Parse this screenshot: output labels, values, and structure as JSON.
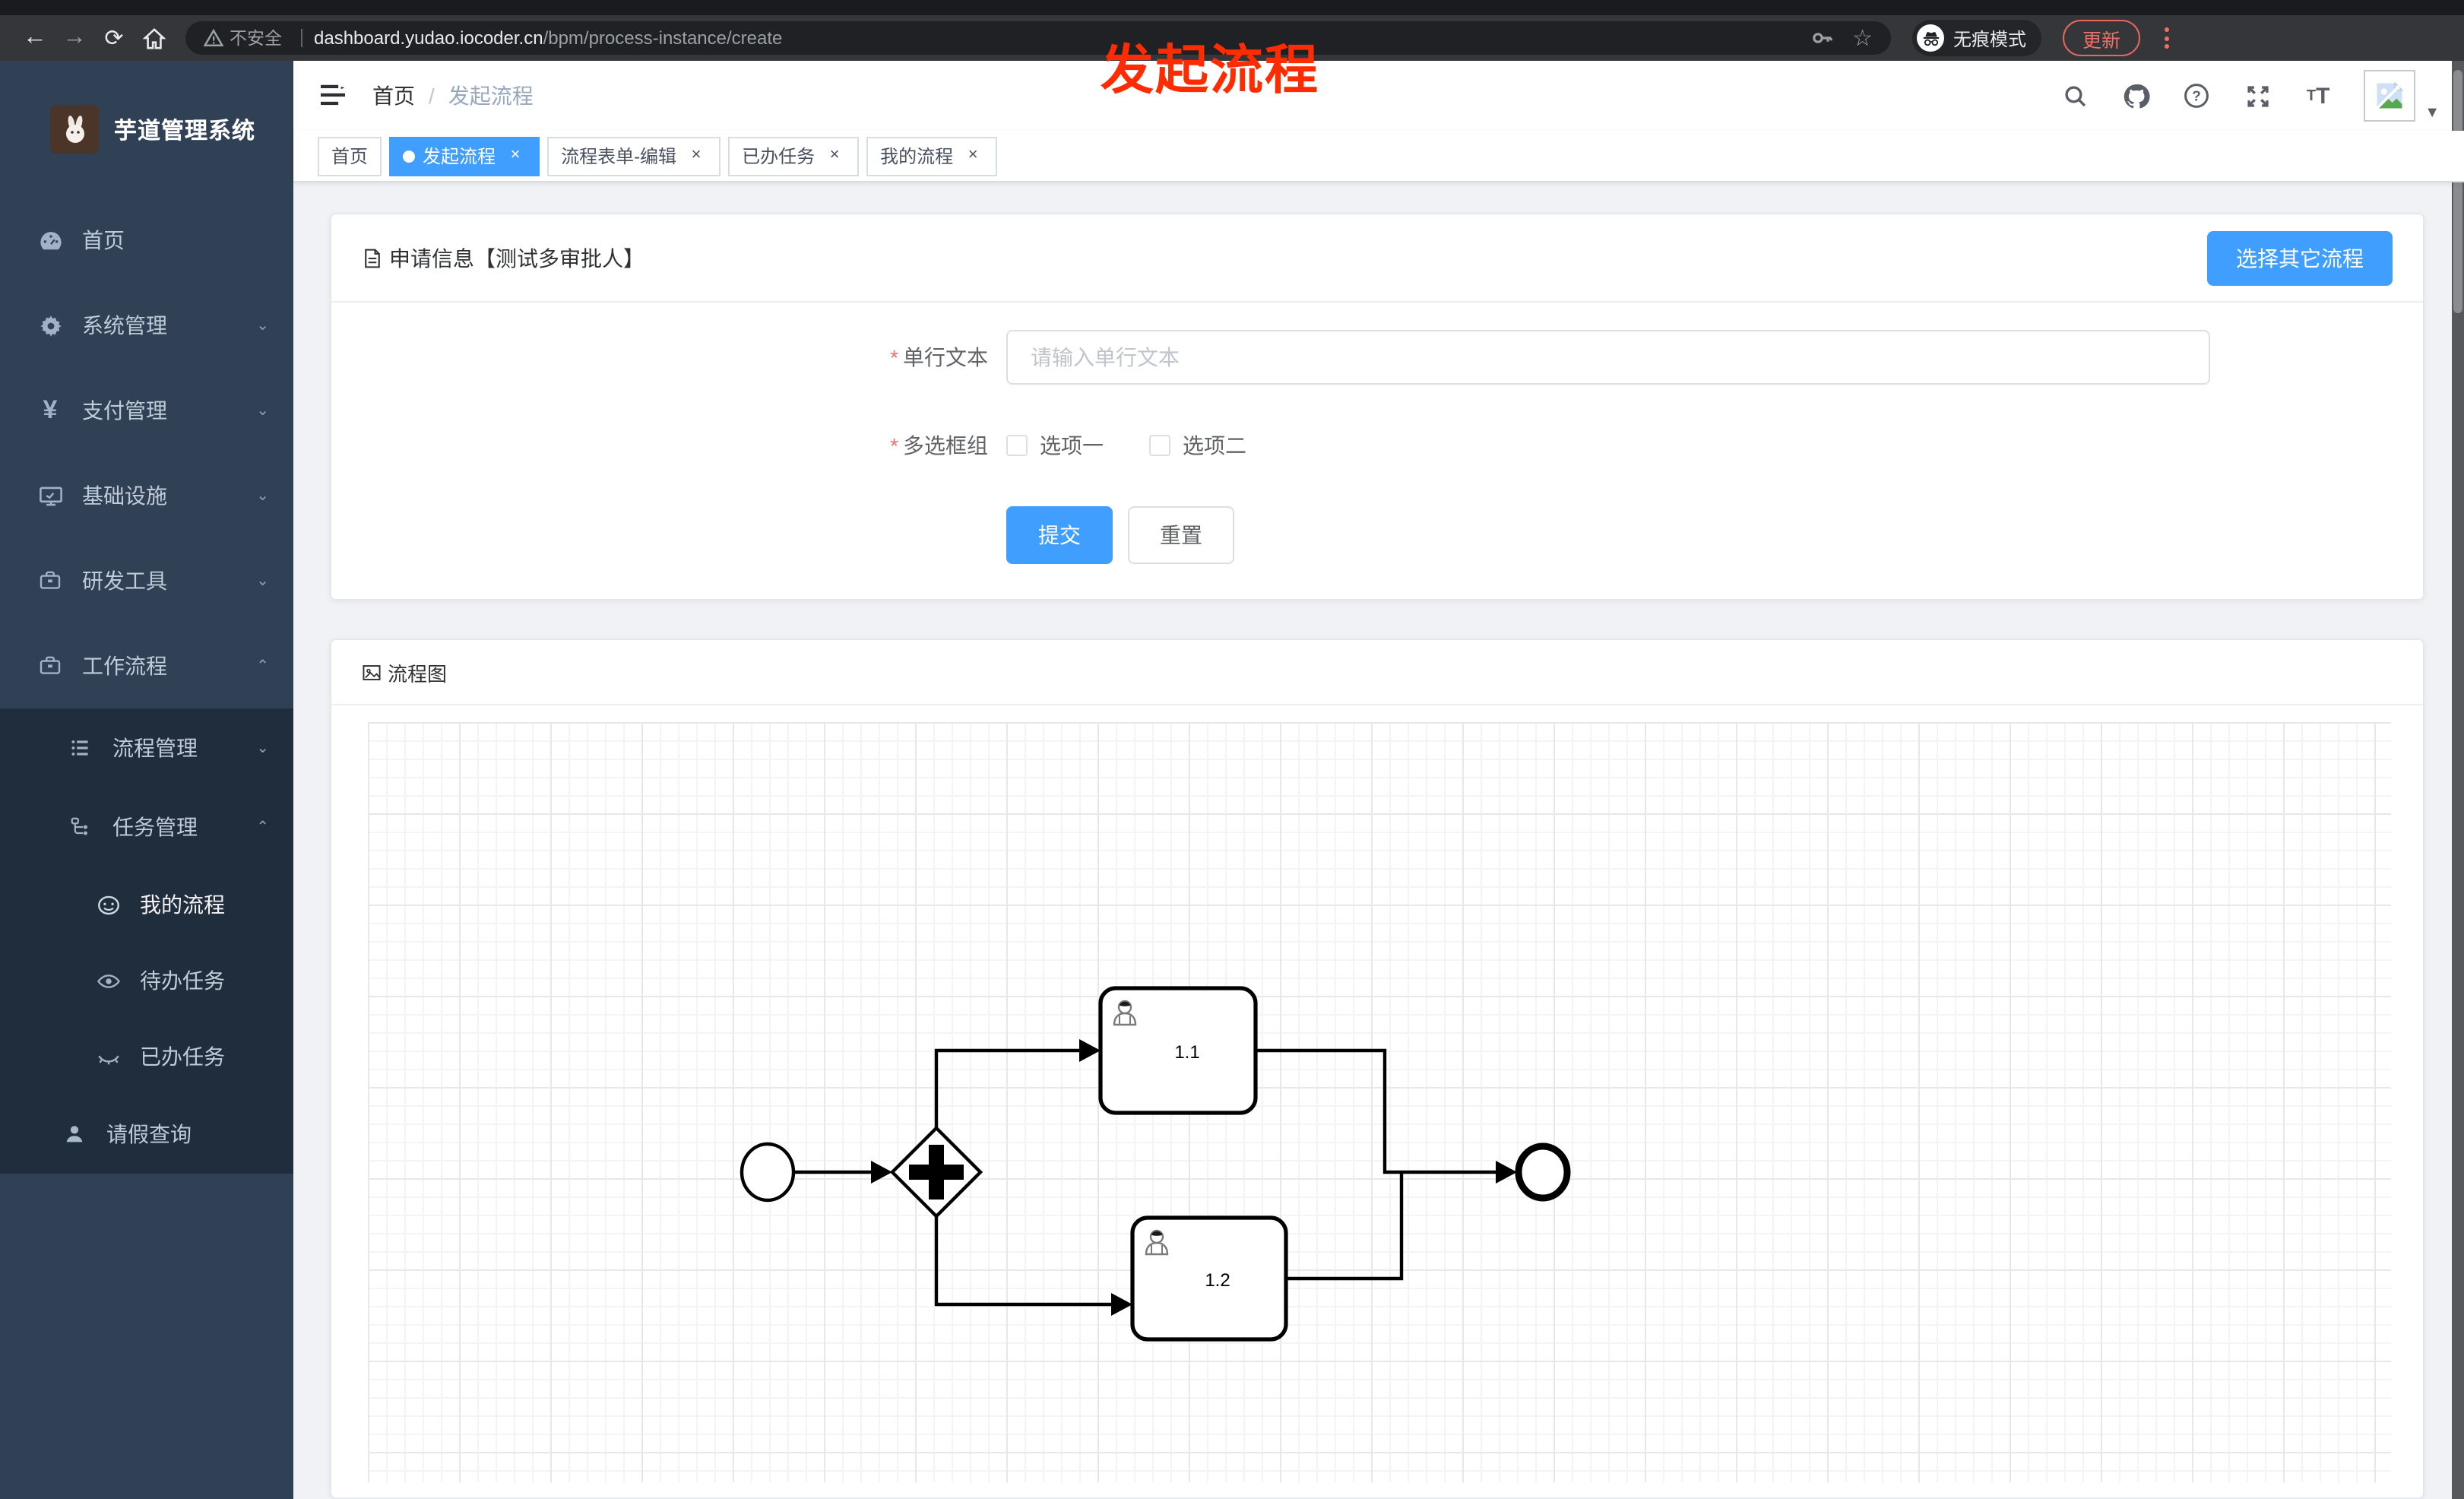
{
  "browser": {
    "security_label": "不安全",
    "url_host": "dashboard.yudao.iocoder.cn",
    "url_path": "/bpm/process-instance/create",
    "incognito_label": "无痕模式",
    "update_label": "更新"
  },
  "annotation": {
    "title": "发起流程",
    "color": "#fe2c00"
  },
  "sidebar": {
    "app_title": "芋道管理系统",
    "items": [
      {
        "label": "首页"
      },
      {
        "label": "系统管理"
      },
      {
        "label": "支付管理"
      },
      {
        "label": "基础设施"
      },
      {
        "label": "研发工具"
      },
      {
        "label": "工作流程"
      },
      {
        "label": "流程管理"
      },
      {
        "label": "任务管理"
      },
      {
        "label": "我的流程"
      },
      {
        "label": "待办任务"
      },
      {
        "label": "已办任务"
      },
      {
        "label": "请假查询"
      }
    ]
  },
  "header": {
    "breadcrumb_home": "首页",
    "breadcrumb_separator": "/",
    "breadcrumb_current": "发起流程"
  },
  "tabs": [
    {
      "label": "首页"
    },
    {
      "label": "发起流程"
    },
    {
      "label": "流程表单-编辑"
    },
    {
      "label": "已办任务"
    },
    {
      "label": "我的流程"
    }
  ],
  "tab_close_glyph": "×",
  "form_card": {
    "title": "申请信息【测试多审批人】",
    "choose_other_label": "选择其它流程",
    "field_text": {
      "label": "单行文本",
      "required": true,
      "value": "",
      "placeholder": "请输入单行文本"
    },
    "field_checkbox": {
      "label": "多选框组",
      "required": true,
      "options": [
        {
          "label": "选项一",
          "checked": false
        },
        {
          "label": "选项二",
          "checked": false
        }
      ]
    },
    "submit_label": "提交",
    "reset_label": "重置"
  },
  "diagram_card": {
    "title": "流程图",
    "diagram": {
      "type": "bpmn",
      "nodes": [
        {
          "id": "start",
          "kind": "start-event",
          "label": ""
        },
        {
          "id": "gateway",
          "kind": "parallel-gateway",
          "label": ""
        },
        {
          "id": "task1",
          "kind": "user-task",
          "label": "1.1"
        },
        {
          "id": "task2",
          "kind": "user-task",
          "label": "1.2"
        },
        {
          "id": "end",
          "kind": "end-event",
          "label": ""
        }
      ],
      "edges": [
        {
          "from": "start",
          "to": "gateway"
        },
        {
          "from": "gateway",
          "to": "task1"
        },
        {
          "from": "gateway",
          "to": "task2"
        },
        {
          "from": "task1",
          "to": "end"
        },
        {
          "from": "task2",
          "to": "end"
        }
      ]
    }
  },
  "colors": {
    "accent_blue": "#409eff",
    "sidebar_bg": "#304156",
    "submenu_bg": "#1f2d3d",
    "annotation_red": "#fe2c00",
    "chrome_toolbar": "#35363a",
    "update_coral": "#ef7065"
  }
}
